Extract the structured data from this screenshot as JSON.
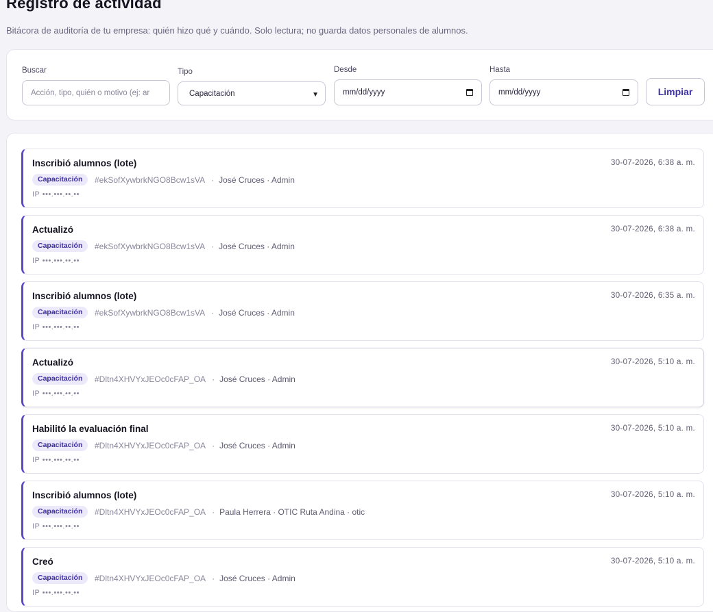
{
  "page": {
    "title": "Registro de actividad",
    "subtitle": "Bitácora de auditoría de tu empresa: quién hizo qué y cuándo. Solo lectura; no guarda datos personales de alumnos."
  },
  "filters": {
    "search_label": "Buscar",
    "search_placeholder": "Acción, tipo, quién o motivo (ej: ar",
    "type_label": "Tipo",
    "type_value": "Capacitación",
    "from_label": "Desde",
    "from_placeholder": "mm/dd/yyyy",
    "to_label": "Hasta",
    "to_placeholder": "mm/dd/yyyy",
    "clear_label": "Limpiar"
  },
  "entries": [
    {
      "title": "Inscribió alumnos (lote)",
      "time": "30-07-2026, 6:38 a. m.",
      "badge": "Capacitación",
      "ref": "#ekSofXywbrkNGO8Bcw1sVA",
      "actor": "José Cruces · Admin",
      "ip": "IP •••.•••.••.••"
    },
    {
      "title": "Actualizó",
      "time": "30-07-2026, 6:38 a. m.",
      "badge": "Capacitación",
      "ref": "#ekSofXywbrkNGO8Bcw1sVA",
      "actor": "José Cruces · Admin",
      "ip": "IP •••.•••.••.••"
    },
    {
      "title": "Inscribió alumnos (lote)",
      "time": "30-07-2026, 6:35 a. m.",
      "badge": "Capacitación",
      "ref": "#ekSofXywbrkNGO8Bcw1sVA",
      "actor": "José Cruces · Admin",
      "ip": "IP •••.•••.••.••"
    },
    {
      "title": "Actualizó",
      "time": "30-07-2026, 5:10 a. m.",
      "badge": "Capacitación",
      "ref": "#Dltn4XHVYxJEOc0cFAP_OA",
      "actor": "José Cruces · Admin",
      "ip": "IP •••.•••.••.••"
    },
    {
      "title": "Habilitó la evaluación final",
      "time": "30-07-2026, 5:10 a. m.",
      "badge": "Capacitación",
      "ref": "#Dltn4XHVYxJEOc0cFAP_OA",
      "actor": "José Cruces · Admin",
      "ip": "IP •••.•••.••.••"
    },
    {
      "title": "Inscribió alumnos (lote)",
      "time": "30-07-2026, 5:10 a. m.",
      "badge": "Capacitación",
      "ref": "#Dltn4XHVYxJEOc0cFAP_OA",
      "actor": "Paula Herrera · OTIC Ruta Andina · otic",
      "ip": "IP •••.•••.••.••"
    },
    {
      "title": "Creó",
      "time": "30-07-2026, 5:10 a. m.",
      "badge": "Capacitación",
      "ref": "#Dltn4XHVYxJEOc0cFAP_OA",
      "actor": "José Cruces · Admin",
      "ip": "IP •••.•••.••.••"
    }
  ]
}
